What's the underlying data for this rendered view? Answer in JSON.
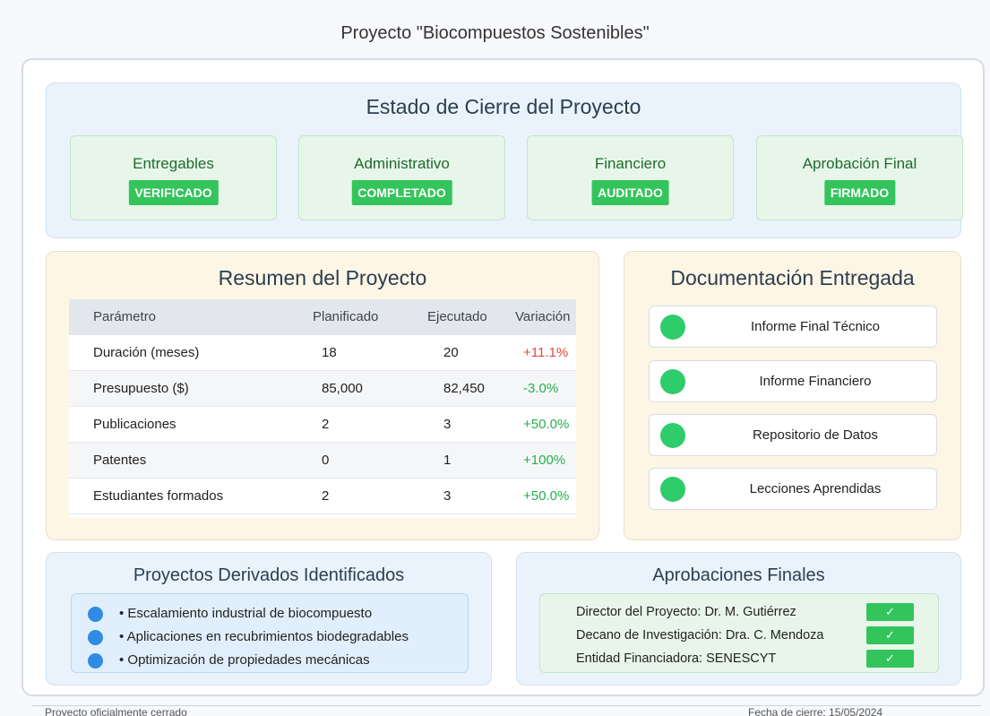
{
  "page": {
    "title": "Proyecto \"Biocompuestos Sostenibles\""
  },
  "status": {
    "title": "Estado de Cierre del Proyecto",
    "items": [
      {
        "name": "Entregables",
        "badge": "VERIFICADO"
      },
      {
        "name": "Administrativo",
        "badge": "COMPLETADO"
      },
      {
        "name": "Financiero",
        "badge": "AUDITADO"
      },
      {
        "name": "Aprobación Final",
        "badge": "FIRMADO"
      }
    ]
  },
  "summary": {
    "title": "Resumen del Proyecto",
    "headers": [
      "Parámetro",
      "Planificado",
      "Ejecutado",
      "Variación"
    ],
    "rows": [
      {
        "param": "Duración (meses)",
        "planned": "18",
        "executed": "20",
        "variation": "+11.1%"
      },
      {
        "param": "Presupuesto ($)",
        "planned": "85,000",
        "executed": "82,450",
        "variation": "-3.0%"
      },
      {
        "param": "Publicaciones",
        "planned": "2",
        "executed": "3",
        "variation": "+50.0%"
      },
      {
        "param": "Patentes",
        "planned": "0",
        "executed": "1",
        "variation": "+100%"
      },
      {
        "param": "Estudiantes formados",
        "planned": "2",
        "executed": "3",
        "variation": "+50.0%"
      }
    ]
  },
  "documents": {
    "title": "Documentación Entregada",
    "items": [
      "Informe Final Técnico",
      "Informe Financiero",
      "Repositorio de Datos",
      "Lecciones Aprendidas"
    ]
  },
  "derived": {
    "title": "Proyectos Derivados Identificados",
    "items": [
      "• Escalamiento industrial de biocompuesto",
      "• Aplicaciones en recubrimientos biodegradables",
      "• Optimización de propiedades mecánicas"
    ]
  },
  "approvals": {
    "title": "Aprobaciones Finales",
    "items": [
      {
        "label": "Director del Proyecto: Dr. M. Gutiérrez",
        "check": "✓"
      },
      {
        "label": "Decano de Investigación: Dra. C. Mendoza",
        "check": "✓"
      },
      {
        "label": "Entidad Financiadora: SENESCYT",
        "check": "✓"
      }
    ]
  },
  "footer": {
    "left": "Proyecto oficialmente cerrado",
    "right": "Fecha de cierre: 15/05/2024"
  },
  "colors": {
    "badge_green": "#34c45c",
    "doc_dot_green": "#2ecc6a",
    "derived_dot_blue": "#2f8be4",
    "variation_positive": "#27ae50",
    "variation_negative": "#e04b3c"
  }
}
